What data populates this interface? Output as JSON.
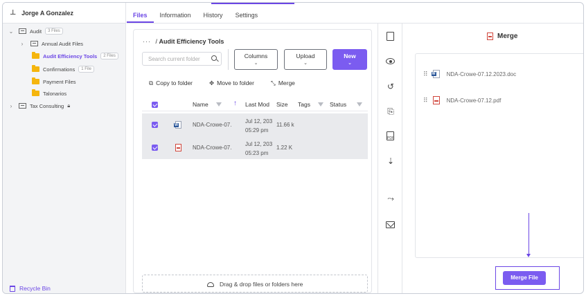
{
  "user": {
    "name": "Jorge A Gonzalez"
  },
  "tree": {
    "audit": {
      "label": "Audit",
      "badge": "3 Files"
    },
    "annual": {
      "label": "Annual Audit Files"
    },
    "efficiency": {
      "label": "Audit Efficiency Tools",
      "badge": "2 Files"
    },
    "confirmations": {
      "label": "Confirmations",
      "badge": "1 File"
    },
    "payment": {
      "label": "Payment Files"
    },
    "talonarios": {
      "label": "Talonarios"
    },
    "tax": {
      "label": "Tax Consulting"
    }
  },
  "recycle_bin": "Recycle Bin",
  "tabs": [
    "Files",
    "Information",
    "History",
    "Settings"
  ],
  "breadcrumb": {
    "dots": "···",
    "sep": "/",
    "current": "Audit Efficiency Tools"
  },
  "search": {
    "placeholder": "Search current folder"
  },
  "buttons": {
    "columns": "Columns",
    "upload": "Upload",
    "new": "New"
  },
  "actions": {
    "copy": "Copy to folder",
    "move": "Move to folder",
    "merge": "Merge"
  },
  "table": {
    "headers": {
      "name": "Name",
      "modified": "Last Mod",
      "size": "Size",
      "tags": "Tags",
      "status": "Status"
    },
    "rows": [
      {
        "name": "NDA-Crowe-07.",
        "date": "Jul 12, 203",
        "time": "05:29 pm",
        "size": "11.66 k"
      },
      {
        "name": "NDA-Crowe-07.",
        "date": "Jul 12, 203",
        "time": "05:23 pm",
        "size": "1.22 K"
      }
    ]
  },
  "dropzone": "Drag & drop files or folders here",
  "merge": {
    "title": "Merge",
    "items": [
      "NDA-Crowe-07.12.2023.doc",
      "NDA-Crowe-07.12.pdf"
    ],
    "button": "Merge File"
  },
  "colors": {
    "accent": "#7b5cf0",
    "folder": "#f5b50d",
    "pdf": "#d0453b",
    "word": "#2b579a"
  }
}
